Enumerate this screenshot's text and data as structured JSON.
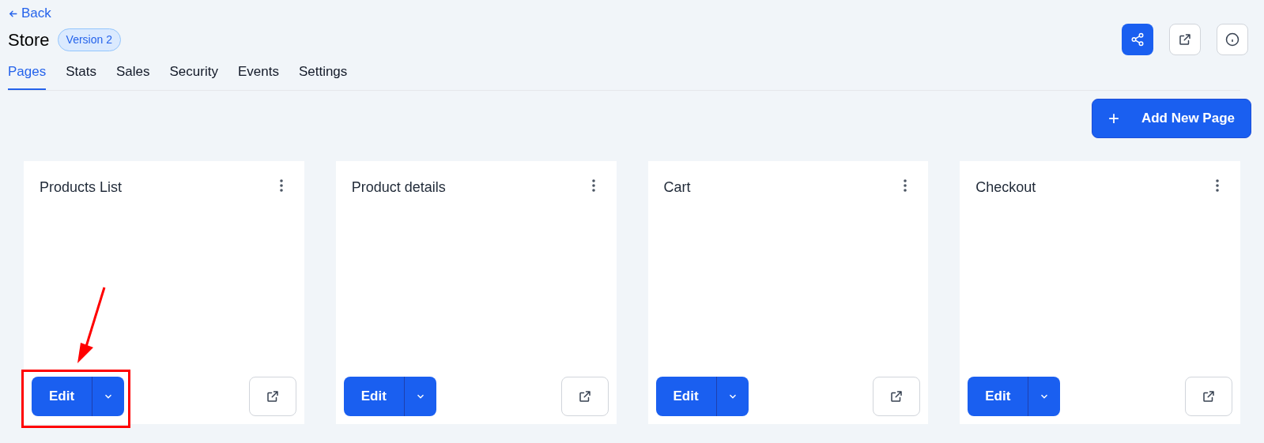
{
  "back_link": {
    "label": "Back"
  },
  "header": {
    "title": "Store",
    "version_badge": "Version 2"
  },
  "tabs": [
    {
      "label": "Pages",
      "selected": true
    },
    {
      "label": "Stats",
      "selected": false
    },
    {
      "label": "Sales",
      "selected": false
    },
    {
      "label": "Security",
      "selected": false
    },
    {
      "label": "Events",
      "selected": false
    },
    {
      "label": "Settings",
      "selected": false
    }
  ],
  "add_button": {
    "icon_glyph": "+",
    "label": "Add New Page"
  },
  "cards": [
    {
      "title": "Products List",
      "edit_label": "Edit",
      "annotated": true
    },
    {
      "title": "Product details",
      "edit_label": "Edit",
      "annotated": false
    },
    {
      "title": "Cart",
      "edit_label": "Edit",
      "annotated": false
    },
    {
      "title": "Checkout",
      "edit_label": "Edit",
      "annotated": false
    }
  ]
}
